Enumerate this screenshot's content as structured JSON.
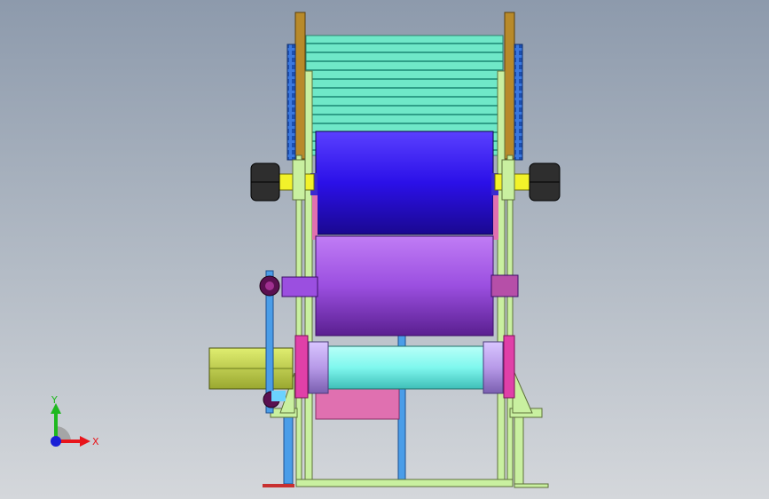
{
  "viewport": {
    "name": "3D model view"
  },
  "triad": {
    "x_label": "X",
    "y_label": "Y",
    "colors": {
      "x_axis": "#e8151b",
      "y_axis": "#1fb81f",
      "z_axis": "#1a1fd6"
    }
  },
  "colors": {
    "background_top": "#8d9aac",
    "background_bottom": "#d4d7db",
    "side_plate": "#b88a2a",
    "conveyor_belt": "#5ce0c0",
    "sprocket_chain": "#3a78e0",
    "roller_blue": "#2b10e8",
    "roller_purple": "#9b4fe0",
    "roller_cyan": "#7ff7ee",
    "frame": "#c9f0a0",
    "knob": "#2e2e2e",
    "shaft_yellow": "#f2f22a",
    "motor": "#c3d444",
    "pink_part": "#e070b0"
  }
}
